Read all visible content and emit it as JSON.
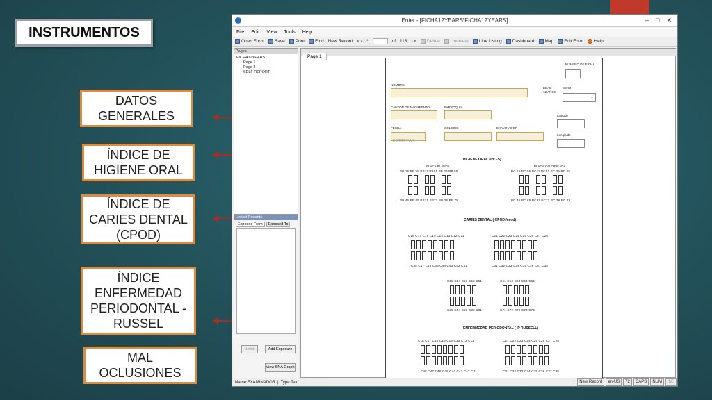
{
  "slide": {
    "title": "INSTRUMENTOS",
    "labels": [
      "DATOS GENERALES",
      "ÍNDICE DE HIGIENE ORAL",
      "ÍNDICE DE CARIES DENTAL (CPOD)",
      "ÍNDICE ENFERMEDAD PERIODONTAL - RUSSEL",
      "MAL OCLUSIONES"
    ]
  },
  "window": {
    "title": "Enter - [FICHA12YEARS\\FICHA12YEARS]",
    "controls": [
      "–",
      "□",
      "✕"
    ]
  },
  "menu": [
    "File",
    "Edit",
    "View",
    "Tools",
    "Help"
  ],
  "toolbar": {
    "open_form": "Open Form",
    "save": "Save",
    "print": "Print",
    "find": "Find",
    "new_record": "New Record",
    "nav_prev": "«  ‹",
    "nav_star": "*",
    "of_label": "of",
    "record_count": "118",
    "nav_next": "›  »",
    "delete": "Delete",
    "undelete": "Undelete",
    "line_listing": "Line Listing",
    "dashboard": "Dashboard",
    "map": "Map",
    "edit_form": "Edit Form",
    "help": "Help"
  },
  "pages_panel": {
    "header": "Pages",
    "root": "FICHA12YEARS",
    "items": [
      "Page 1",
      "Page 2",
      "SELF REPORT"
    ]
  },
  "linked_panel": {
    "header": "Linked Records",
    "tab_from": "Exposed From",
    "tab_to": "Exposed To",
    "unlink": "Unlink",
    "add_exposure": "Add Exposure",
    "view_sna": "View SNA Graph"
  },
  "page_tab": "Page 1",
  "form": {
    "numero_ficha": "NUMERO DE FICHA",
    "nombre": "NOMBRE:",
    "edad": "EDAD :",
    "edad_val": "12 AÑOS",
    "sexo": "SEXO",
    "canton": "CANTÓN DE NACIMIENTO",
    "parroquia": "PARROQUIA",
    "latitude": "Latitude",
    "longitude": "Longitude",
    "fecha": "FECHA",
    "fecha_ph": "DD/MM/YYYY",
    "colegio": "COLEGIO",
    "examinador": "EXAMINADOR",
    "higiene_title": "HIGIENE ORAL (IHO-S)",
    "placa_blanda": "PLACA BLANDA",
    "placa_calcificada": "PLACA CALCIFICADA",
    "pb_top": "PB 16  PB 55    PB11  PB51    PB 26  PB 65",
    "pb_bottom": "PB 46    PB 85   PB31    PB71  PB 36  PB 75",
    "pc_top": "PC 16  PC 55    PC11  PC51    PC 26  PC 65",
    "pc_bottom": "PC 46    PC 85   PC31    PC71  PC 36  PC 75",
    "caries_title": "CARIES DENTAL ( CPOD /ceod)",
    "c_top_left": "C18  C17  C16  C15  C14  C13 C12 C11",
    "c_top_right": "C21  C22 C23 C24 C25 C26 C27 C28",
    "c_bottom_left": "C48  C47 C46  C45   C44  C43 C42 C41",
    "c_bottom_right": "C31  C32 C33 C34 C35 C36 C37 C38",
    "c_mid_top_left": "C55  C54  C53 C52 C51",
    "c_mid_top_right": "C61 C62 C63 C64 C65",
    "c_mid_bottom_left": "C85  C84  C83 C82 C81",
    "c_mid_bottom_right": "C71  C72 C73 C74 C75",
    "perio_title": "ENFERMEDAD PERIODONTAL ( IP RUSSELL)",
    "p_top_left": "C18  C17  C16  C15  C14  C13  C12  C11",
    "p_top_right": "C21  C22 C23 C24 C25 C26 C27 C28",
    "p_bottom_left": "C48   C47 C46   C45    C44  C43 C42 C41",
    "p_bottom_right": "C31  C32 C33 C34 C35 C36 C37 C38"
  },
  "status": {
    "field": "Name:EXAMINADOR",
    "type": "Type:Text",
    "new_record": "New Record",
    "locale": "en-US",
    "count": "72",
    "caps": "CAPS",
    "num": "NUM",
    "ins": "INS"
  }
}
